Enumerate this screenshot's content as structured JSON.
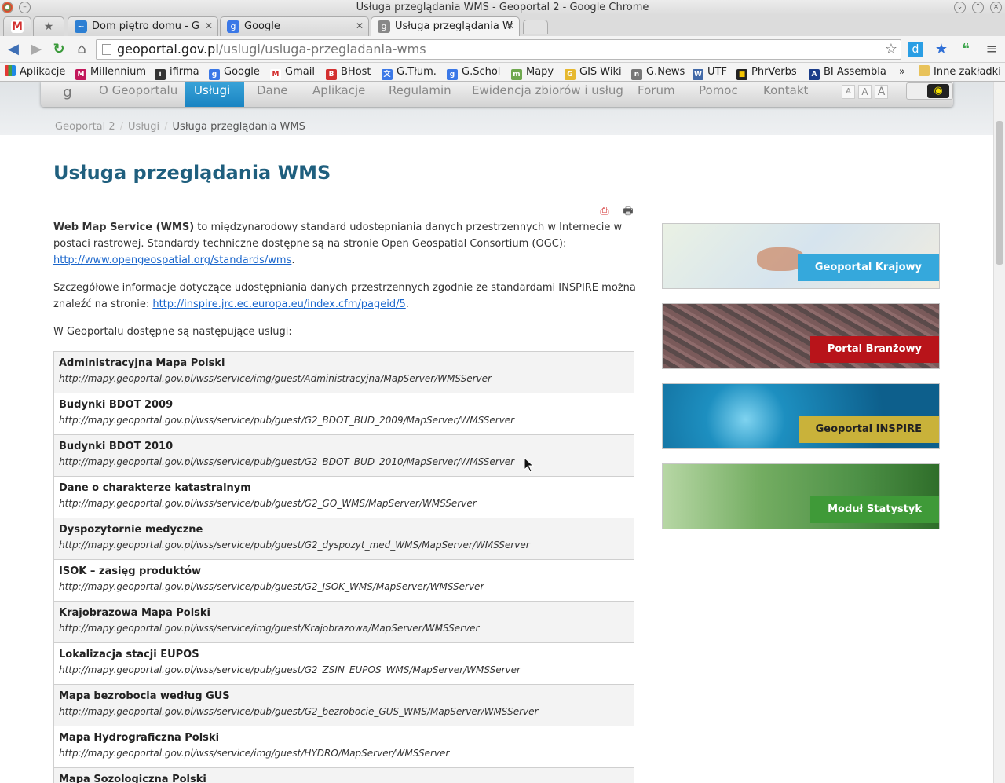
{
  "window": {
    "title": "Usługa przeglądania WMS - Geoportal 2 - Google Chrome"
  },
  "tabs": [
    {
      "label": "",
      "icon": "gmail-icon"
    },
    {
      "label": "",
      "icon": "star-icon"
    },
    {
      "label": "Dom piętro domu - G",
      "icon": "doc-icon"
    },
    {
      "label": "Google",
      "icon": "google-icon"
    },
    {
      "label": "Usługa przeglądania W",
      "icon": "geoportal-icon"
    }
  ],
  "address": {
    "host": "geoportal.gov.pl",
    "path": "/uslugi/usluga-przegladania-wms"
  },
  "bookmarks": [
    "Aplikacje",
    "Millennium",
    "ifirma",
    "Google",
    "Gmail",
    "BHost",
    "G.Tłum.",
    "G.Schol",
    "Mapy",
    "GIS Wiki",
    "G.News",
    "UTF",
    "PhrVerbs",
    "BI Assembla",
    "»",
    "Inne zakładki"
  ],
  "nav": {
    "items": [
      "O Geoportalu",
      "Usługi",
      "Dane",
      "Aplikacje",
      "Regulamin",
      "Ewidencja zbiorów i usług",
      "Forum",
      "Pomoc",
      "Kontakt"
    ],
    "font_sizes": [
      "A",
      "A",
      "A"
    ]
  },
  "breadcrumb": {
    "items": [
      "Geoportal 2",
      "Usługi",
      "Usługa przeglądania WMS"
    ],
    "separator": "/"
  },
  "page": {
    "title": "Usługa przeglądania WMS",
    "intro_bold": "Web Map Service (WMS)",
    "intro_rest": " to międzynarodowy standard udostępniania danych przestrzennych w Internecie w postaci rastrowej. Standardy techniczne dostępne są na stronie Open Geospatial Consortium (OGC): ",
    "intro_link": "http://www.opengeospatial.org/standards/wms",
    "intro_end": ".",
    "inspire_text": "Szczegółowe informacje dotyczące udostępniania danych przestrzennych zgodnie ze standardami INSPIRE można znaleźć na stronie: ",
    "inspire_link": "http://inspire.jrc.ec.europa.eu/index.cfm/pageid/5",
    "inspire_end": ".",
    "list_intro": "W Geoportalu dostępne są następujące usługi:"
  },
  "services": [
    {
      "name": "Administracyjna Mapa Polski",
      "url": "http://mapy.geoportal.gov.pl/wss/service/img/guest/Administracyjna/MapServer/WMSServer"
    },
    {
      "name": "Budynki BDOT 2009",
      "url": "http://mapy.geoportal.gov.pl/wss/service/pub/guest/G2_BDOT_BUD_2009/MapServer/WMSServer"
    },
    {
      "name": "Budynki BDOT 2010",
      "url": "http://mapy.geoportal.gov.pl/wss/service/pub/guest/G2_BDOT_BUD_2010/MapServer/WMSServer"
    },
    {
      "name": "Dane o charakterze katastralnym",
      "url": "http://mapy.geoportal.gov.pl/wss/service/pub/guest/G2_GO_WMS/MapServer/WMSServer"
    },
    {
      "name": "Dyspozytornie medyczne",
      "url": "http://mapy.geoportal.gov.pl/wss/service/pub/guest/G2_dyspozyt_med_WMS/MapServer/WMSServer"
    },
    {
      "name": "ISOK – zasięg produktów",
      "url": "http://mapy.geoportal.gov.pl/wss/service/pub/guest/G2_ISOK_WMS/MapServer/WMSServer"
    },
    {
      "name": "Krajobrazowa Mapa Polski",
      "url": "http://mapy.geoportal.gov.pl/wss/service/img/guest/Krajobrazowa/MapServer/WMSServer"
    },
    {
      "name": "Lokalizacja stacji EUPOS",
      "url": "http://mapy.geoportal.gov.pl/wss/service/pub/guest/G2_ZSIN_EUPOS_WMS/MapServer/WMSServer"
    },
    {
      "name": "Mapa bezrobocia według GUS",
      "url": "http://mapy.geoportal.gov.pl/wss/service/pub/guest/G2_bezrobocie_GUS_WMS/MapServer/WMSServer"
    },
    {
      "name": "Mapa Hydrograficzna Polski",
      "url": "http://mapy.geoportal.gov.pl/wss/service/img/guest/HYDRO/MapServer/WMSServer"
    },
    {
      "name": "Mapa Sozologiczna Polski",
      "url": ""
    }
  ],
  "banners": [
    {
      "label": "Geoportal Krajowy",
      "color": "#35a8dc"
    },
    {
      "label": "Portal Branżowy",
      "color": "#b8141a"
    },
    {
      "label": "Geoportal INSPIRE",
      "color": "#c9b23a"
    },
    {
      "label": "Moduł Statystyk",
      "color": "#3f9a38"
    }
  ],
  "colors": {
    "title": "#1f5f7e",
    "nav_active": "#1f8ac8",
    "link": "#1a66cc"
  }
}
